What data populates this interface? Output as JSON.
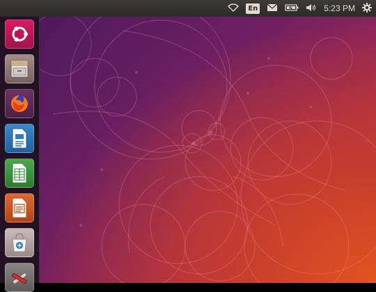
{
  "topbar": {
    "language": "En",
    "clock": "5:23 PM",
    "indicators": [
      "network-icon",
      "keyboard-language-icon",
      "mail-icon",
      "battery-icon",
      "volume-icon",
      "clock",
      "settings-gear-icon"
    ]
  },
  "launcher": {
    "items": [
      {
        "name": "ubuntu-dash",
        "icon": "ubuntu-logo-icon",
        "bg": "#c2185b"
      },
      {
        "name": "files",
        "icon": "file-cabinet-icon",
        "bg": "#8a6f6f"
      },
      {
        "name": "firefox",
        "icon": "firefox-icon",
        "bg": "#5b2a52"
      },
      {
        "name": "libreoffice-writer",
        "icon": "writer-icon",
        "bg": "#2f7fc0"
      },
      {
        "name": "libreoffice-calc",
        "icon": "calc-icon",
        "bg": "#3f9a3f"
      },
      {
        "name": "libreoffice-impress",
        "icon": "impress-icon",
        "bg": "#d35a1f"
      },
      {
        "name": "ubuntu-software",
        "icon": "software-bag-icon",
        "bg": "#b8a7a7"
      },
      {
        "name": "system-settings",
        "icon": "settings-tools-icon",
        "bg": "#6e6a6a"
      }
    ]
  },
  "colors": {
    "topbar": "#2c2b27",
    "wallpaper_start": "#4e1a5c",
    "wallpaper_end": "#e2531d",
    "accent": "#e95420"
  }
}
